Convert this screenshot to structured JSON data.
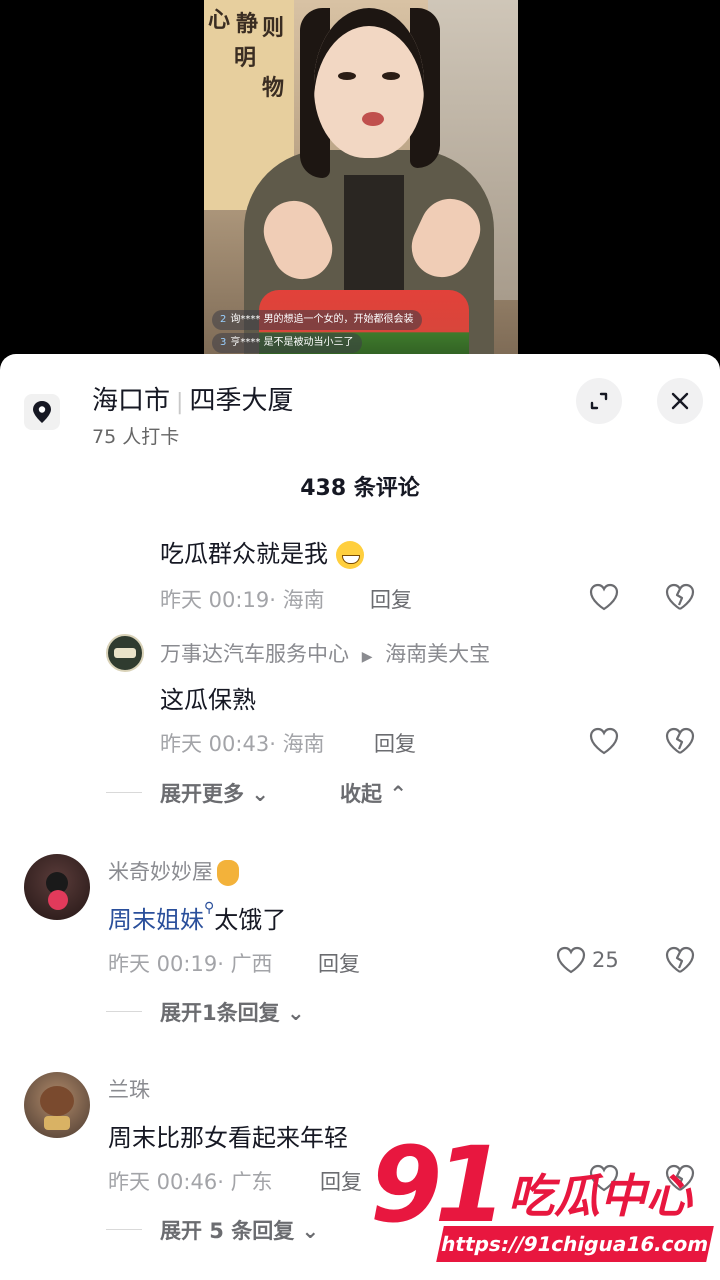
{
  "video": {
    "danmaku": [
      {
        "level": "2",
        "user": "询****",
        "text": "男的想追一个女的，开始都很会装"
      },
      {
        "level": "3",
        "user": "亨****",
        "text": "是不是被动当小三了"
      }
    ],
    "scroll_chars": [
      "心",
      "静",
      "则",
      "明",
      "物"
    ]
  },
  "location": {
    "city": "海口市",
    "place": "四季大厦",
    "checkins": "75 人打卡"
  },
  "comments_count": "438 条评论",
  "replies_thread": [
    {
      "text": "吃瓜群众就是我",
      "time": "昨天 00:19",
      "region": "海南",
      "reply_label": "回复"
    },
    {
      "author": "万事达汽车服务中心",
      "reply_to": "海南美大宝",
      "text": "这瓜保熟",
      "time": "昨天 00:43",
      "region": "海南",
      "reply_label": "回复"
    }
  ],
  "thread_controls": {
    "expand_more": "展开更多",
    "collapse": "收起"
  },
  "comments": [
    {
      "author": "米奇妙妙屋",
      "link_text": "周末姐妹",
      "text": "太饿了",
      "time": "昨天 00:19",
      "region": "广西",
      "reply_label": "回复",
      "likes": "25",
      "expand": "展开1条回复"
    },
    {
      "author": "兰珠",
      "text": "周末比那女看起来年轻",
      "time": "昨天 00:46",
      "region": "广东",
      "reply_label": "回复",
      "expand": "展开 5 条回复"
    }
  ],
  "watermark": {
    "number": "91",
    "name": "吃瓜中心",
    "url": "https://91chigua16.com"
  },
  "colors": {
    "accent_red": "#e8173f",
    "link_blue": "#2a4f9b",
    "text_primary": "#161823",
    "text_meta": "#a3a4a8"
  }
}
